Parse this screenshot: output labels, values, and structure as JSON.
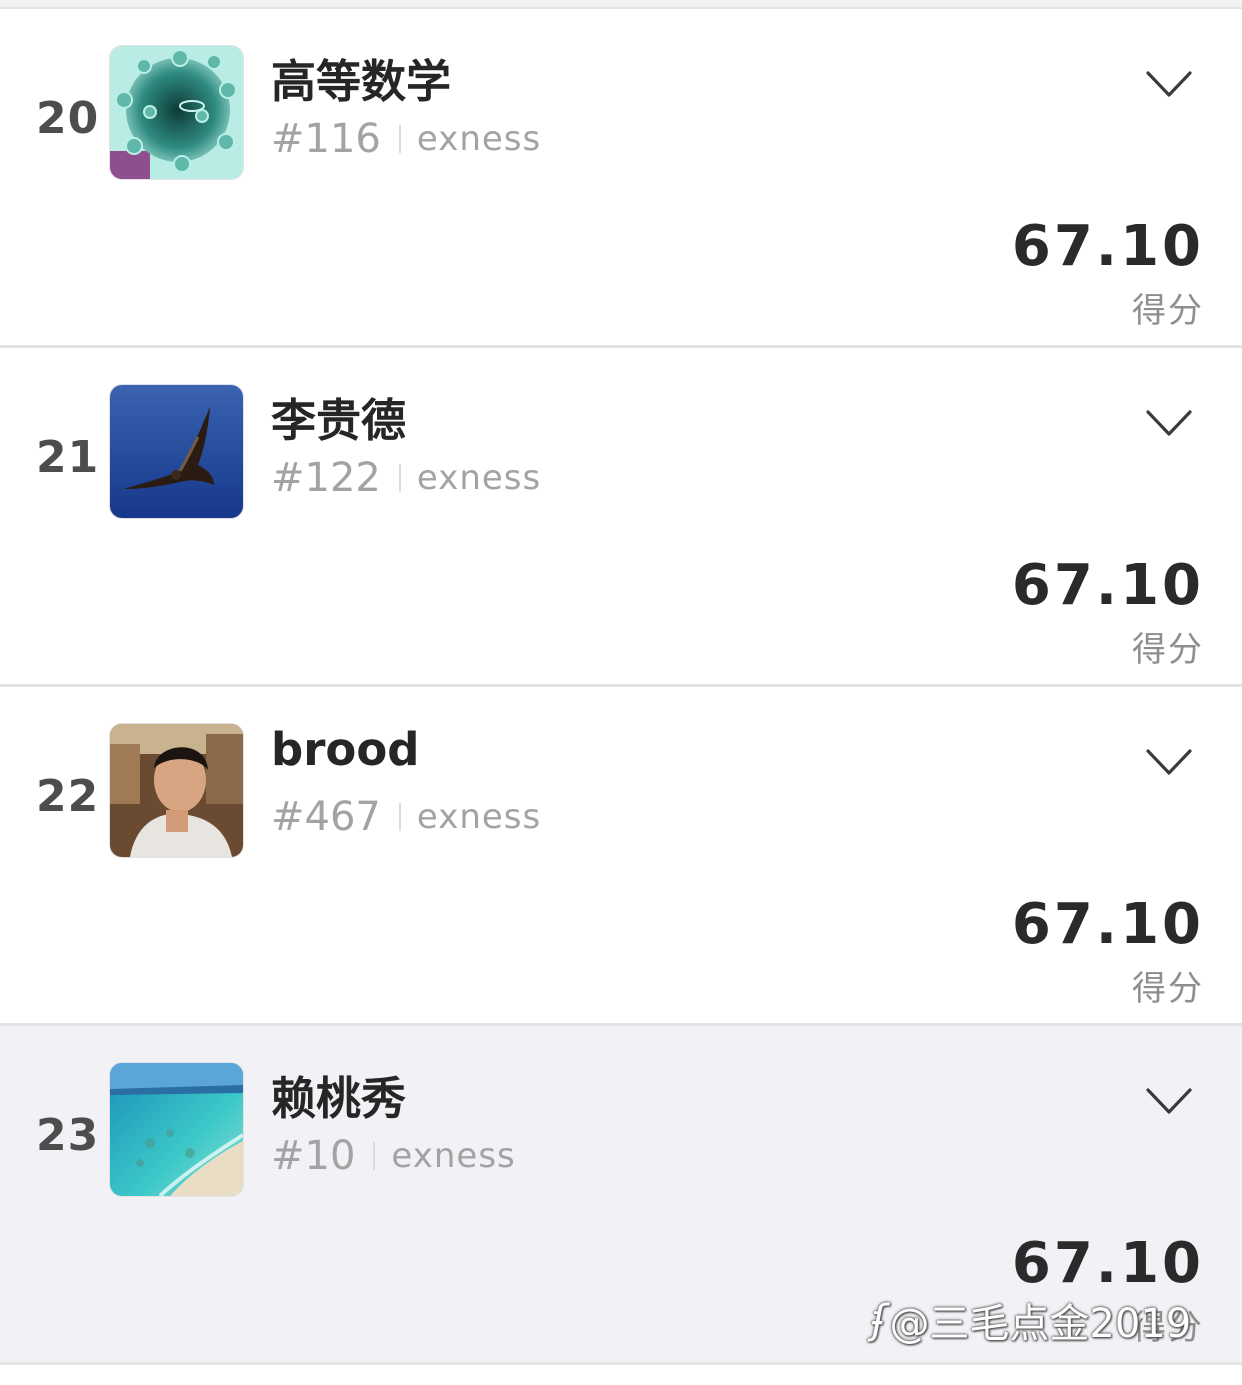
{
  "rows": [
    {
      "rank": "20",
      "name": "高等数学",
      "id": "#116",
      "broker": "exness",
      "score": "67.10",
      "score_label": "得分",
      "avatar": "virus-avatar",
      "highlighted": false
    },
    {
      "rank": "21",
      "name": "李贵德",
      "id": "#122",
      "broker": "exness",
      "score": "67.10",
      "score_label": "得分",
      "avatar": "eagle-avatar",
      "highlighted": false
    },
    {
      "rank": "22",
      "name": "brood",
      "id": "#467",
      "broker": "exness",
      "score": "67.10",
      "score_label": "得分",
      "avatar": "person-avatar",
      "highlighted": false
    },
    {
      "rank": "23",
      "name": "赖桃秀",
      "id": "#10",
      "broker": "exness",
      "score": "67.10",
      "score_label": "得分",
      "avatar": "beach-avatar",
      "highlighted": true
    }
  ],
  "watermark": {
    "logo": "ʄ",
    "text": "@三毛点金2019"
  },
  "colors": {
    "highlight_row_bg": "#f2f2f6",
    "text_dark": "#262626",
    "text_muted": "#a3a3a3",
    "divider": "#e4e4e7"
  }
}
